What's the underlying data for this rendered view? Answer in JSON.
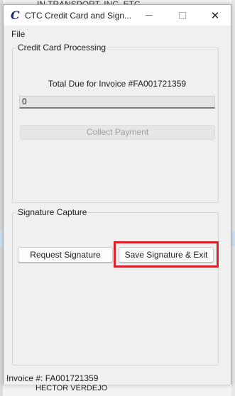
{
  "window": {
    "title": "CTC Credit Card and Sign...",
    "app_icon_glyph": "C",
    "icon": "ctc-app-icon",
    "controls": [
      "minimize",
      "maximize",
      "close"
    ]
  },
  "menu": {
    "file_label": "File"
  },
  "credit_card_group": {
    "legend": "Credit Card Processing",
    "total_label": "Total Due for Invoice #FA001721359",
    "amount_value": "0",
    "collect_label": "Collect Payment",
    "collect_enabled": false
  },
  "signature_group": {
    "legend": "Signature Capture",
    "request_label": "Request Signature",
    "save_label": "Save Signature & Exit"
  },
  "status": {
    "invoice_text": "Invoice #: FA001721359"
  },
  "background_app": {
    "top_text": "IN TRANSPORT, INC. ETC",
    "bottom_text": "HECTOR VERDEJO"
  },
  "colors": {
    "highlight": "#d8222b",
    "window_bg": "#f0f0f0",
    "selection": "#cce4f7"
  }
}
